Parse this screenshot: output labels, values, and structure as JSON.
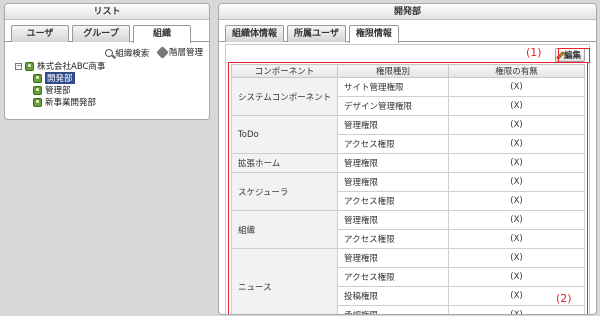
{
  "left_panel": {
    "title": "リスト",
    "tabs": [
      {
        "label": "ユーザ",
        "active": false
      },
      {
        "label": "グループ",
        "active": false
      },
      {
        "label": "組織",
        "active": true
      }
    ],
    "tools": {
      "search_label": "組織検索",
      "manage_label": "階層管理"
    },
    "tree": {
      "root": "株式会社ABC商事",
      "root_expander": "−",
      "children": [
        "開発部",
        "管理部",
        "新事業開発部"
      ],
      "selected": "開発部"
    }
  },
  "right_panel": {
    "title": "開発部",
    "tabs": [
      {
        "label": "組織体情報",
        "active": false
      },
      {
        "label": "所属ユーザ",
        "active": false
      },
      {
        "label": "権限情報",
        "active": true
      }
    ],
    "edit_label": "編集",
    "annotations": {
      "edit": "(1)",
      "table": "(2)"
    },
    "table": {
      "headers": [
        "コンポーネント",
        "権限種別",
        "権限の有無"
      ],
      "rows": [
        {
          "component": "システムコンポーネント",
          "perms": [
            {
              "type": "サイト管理権限",
              "value": "(X)"
            },
            {
              "type": "デザイン管理権限",
              "value": "(X)"
            }
          ]
        },
        {
          "component": "ToDo",
          "perms": [
            {
              "type": "管理権限",
              "value": "(X)"
            },
            {
              "type": "アクセス権限",
              "value": "(X)"
            }
          ]
        },
        {
          "component": "拡張ホーム",
          "perms": [
            {
              "type": "管理権限",
              "value": "(X)"
            }
          ]
        },
        {
          "component": "スケジューラ",
          "perms": [
            {
              "type": "管理権限",
              "value": "(X)"
            },
            {
              "type": "アクセス権限",
              "value": "(X)"
            }
          ]
        },
        {
          "component": "組織",
          "perms": [
            {
              "type": "管理権限",
              "value": "(X)"
            },
            {
              "type": "アクセス権限",
              "value": "(X)"
            }
          ]
        },
        {
          "component": "ニュース",
          "perms": [
            {
              "type": "管理権限",
              "value": "(X)"
            },
            {
              "type": "アクセス権限",
              "value": "(X)"
            },
            {
              "type": "投稿権限",
              "value": "(X)"
            },
            {
              "type": "承認権限",
              "value": "(X)"
            }
          ]
        }
      ]
    }
  },
  "colors": {
    "annotation": "#e8212a",
    "selection": "#2f4b8c"
  }
}
